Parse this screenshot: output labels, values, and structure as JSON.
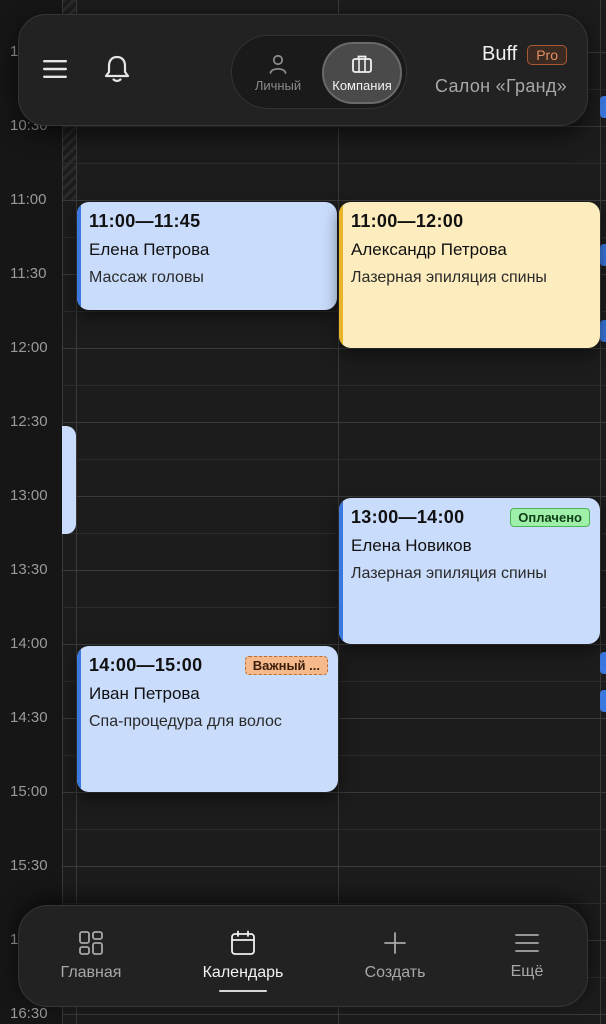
{
  "header": {
    "menu_icon": "hamburger-menu-icon",
    "bell_icon": "bell-icon",
    "segment": {
      "personal_label": "Личный",
      "company_label": "Компания",
      "selected": "company"
    },
    "brand_name": "Buff",
    "plan_badge": "Pro",
    "salon_name": "Салон «Гранд»"
  },
  "time_labels": [
    "1",
    "10:30",
    "11:00",
    "11:30",
    "12:00",
    "12:30",
    "13:00",
    "13:30",
    "14:00",
    "14:30",
    "15:00",
    "15:30",
    "1",
    "16:30"
  ],
  "events": [
    {
      "time": "11:00—11:45",
      "client": "Елена Петрова",
      "service": "Массаж головы",
      "color": "#c9dcfb",
      "badge": ""
    },
    {
      "time": "11:00—12:00",
      "client": "Александр Петрова",
      "service": "Лазерная эпиляция спины",
      "color": "#fdecbd",
      "badge": ""
    },
    {
      "time": "13:00—14:00",
      "client": "Елена Новиков",
      "service": "Лазерная эпиляция спины",
      "color": "#c9dcfb",
      "badge": "Оплачено"
    },
    {
      "time": "14:00—15:00",
      "client": "Иван Петрова",
      "service": "Спа-процедура для волос",
      "color": "#c9dcfb",
      "badge": "Важный ..."
    }
  ],
  "bottom_nav": {
    "items": [
      {
        "label": "Главная",
        "icon": "grid-icon"
      },
      {
        "label": "Календарь",
        "icon": "calendar-icon",
        "active": true
      },
      {
        "label": "Создать",
        "icon": "plus-icon"
      },
      {
        "label": "Ещё",
        "icon": "more-menu-icon"
      }
    ]
  }
}
